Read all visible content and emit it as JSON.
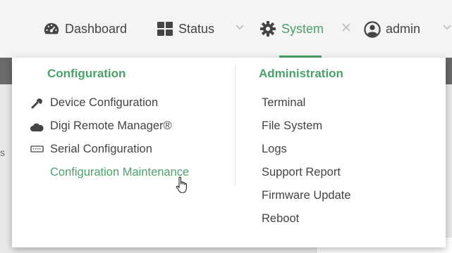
{
  "topnav": {
    "dashboard_label": "Dashboard",
    "status_label": "Status",
    "system_label": "System",
    "user_label": "admin"
  },
  "dropdown": {
    "configuration": {
      "heading": "Configuration",
      "items": [
        {
          "label": "Device Configuration",
          "icon": "wrench-icon"
        },
        {
          "label": "Digi Remote Manager®",
          "icon": "cloud-icon"
        },
        {
          "label": "Serial Configuration",
          "icon": "serial-port-icon"
        },
        {
          "label": "Configuration Maintenance",
          "icon": ""
        }
      ]
    },
    "administration": {
      "heading": "Administration",
      "items": [
        {
          "label": "Terminal"
        },
        {
          "label": "File System"
        },
        {
          "label": "Logs"
        },
        {
          "label": "Support Report"
        },
        {
          "label": "Firmware Update"
        },
        {
          "label": "Reboot"
        }
      ]
    }
  },
  "background": {
    "edge_char": "s"
  },
  "colors": {
    "accent": "#4aa16a",
    "text": "#444444",
    "topbar": "#f4f4f4"
  }
}
